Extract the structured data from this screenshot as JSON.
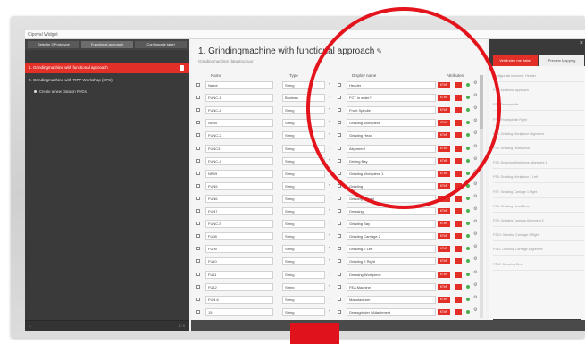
{
  "window": {
    "title": "Cipoval Widget"
  },
  "sidebar": {
    "tabs": [
      "Selectie 3 Prototype",
      "Functional approach",
      "Configuratie tabel"
    ],
    "items": [
      {
        "label": "1. Grindingmachine with functional approach",
        "active": true
      },
      {
        "label": "2. Grindingmachine with TIPP Workshop (EFS)",
        "active": false
      }
    ],
    "sub_items": [
      {
        "label": "Create a new Data on FHGs"
      }
    ],
    "footer_left": "←",
    "footer_right": "1 / 5"
  },
  "main": {
    "title": "1. Grindingmachine with functional approach",
    "subtitle": "Grindingmachine datastructuur",
    "columns": {
      "name": "Name",
      "type": "Type",
      "display": "Display name",
      "attributes": "Attributes"
    },
    "tag_label": "KT#R",
    "rows": [
      {
        "name": "Name",
        "type": "String",
        "display": "Header"
      },
      {
        "name": "FUNC-1",
        "type": "Boolean",
        "display": "FCT in order?"
      },
      {
        "name": "FUNC-A",
        "type": "String",
        "display": "Front Spindle"
      },
      {
        "name": "NR00",
        "type": "String",
        "display": "Grinding Workpiece"
      },
      {
        "name": "FUNC-2",
        "type": "String",
        "display": "Grinding Head"
      },
      {
        "name": "FUNC3",
        "type": "String",
        "display": "Alignment"
      },
      {
        "name": "FUNC-4",
        "type": "String",
        "display": "Driving Bay"
      },
      {
        "name": "NR09",
        "type": "String",
        "display": "Grinding Workpiece 1"
      },
      {
        "name": "FUN5",
        "type": "String",
        "display": "Grinding"
      },
      {
        "name": "FUN6",
        "type": "String",
        "display": "Grinding / Right"
      },
      {
        "name": "FUN7",
        "type": "String",
        "display": "Dressing"
      },
      {
        "name": "FUNC-5",
        "type": "String",
        "display": "Grinding Bay"
      },
      {
        "name": "FU08",
        "type": "String",
        "display": "Grinding Carriage 2"
      },
      {
        "name": "FU09",
        "type": "String",
        "display": "Grinding 2 Left"
      },
      {
        "name": "FU10",
        "type": "String",
        "display": "Grinding 2 Right"
      },
      {
        "name": "FU11",
        "type": "String",
        "display": "Dressing Workpiece"
      },
      {
        "name": "FU12",
        "type": "String",
        "display": "FEA Machine"
      },
      {
        "name": "FUN-6",
        "type": "String",
        "display": "Manufacturer"
      },
      {
        "name": "15",
        "type": "String",
        "display": "Dressgrinder / Attachment"
      }
    ]
  },
  "right_panel": {
    "tabs": [
      "Verbinden met tabel",
      "Preview Mapping"
    ],
    "items": [
      "Configuratie kenmerk: Header",
      "FCT: functional approach",
      "FS1: Frontspindle",
      "FS2: Frontspindle Right",
      "FS3: Grinding Workpiece Alignment",
      "FS4: Grinding Head Drive",
      "FS5: Dressing Workpiece Alignment 1",
      "FS6: Grinding Workpiece 1 Left",
      "FS7: Grinding Carriage 1 Right",
      "FS8: Grinding Head Drive",
      "FS9: Grinding Carriage Alignment 2",
      "FS10: Grinding Carriage 2 Right",
      "FS11: Grinding Carriage Alignment",
      "FS12: Dressing Drive"
    ]
  },
  "colors": {
    "accent": "#e23028",
    "sidebar_bg": "#3a3a3a",
    "highlight_circle": "#e3141c"
  }
}
